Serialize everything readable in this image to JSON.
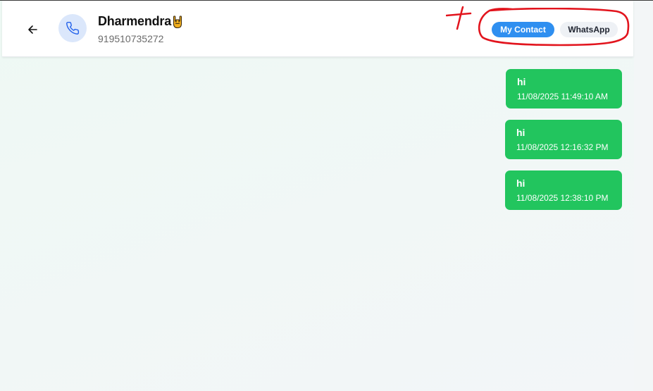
{
  "header": {
    "contact_name": "Dharmendra",
    "contact_phone": "919510735272",
    "badges": {
      "my_contact": "My Contact",
      "whatsapp": "WhatsApp"
    }
  },
  "icons": {
    "back": "arrow-left-icon",
    "avatar": "phone-icon",
    "name_emoji": "sign-of-horns-emoji"
  },
  "messages": [
    {
      "text": "hi",
      "time": "11/08/2025 11:49:10 AM"
    },
    {
      "text": "hi",
      "time": "11/08/2025 12:16:32 PM"
    },
    {
      "text": "hi",
      "time": "11/08/2025 12:38:10 PM"
    }
  ],
  "colors": {
    "bubble": "#22c55e",
    "my_contact_badge": "#2f8ff0",
    "whatsapp_badge": "#eef1f5",
    "annotation": "#e2141d",
    "avatar_bg": "#dbe7fb"
  }
}
